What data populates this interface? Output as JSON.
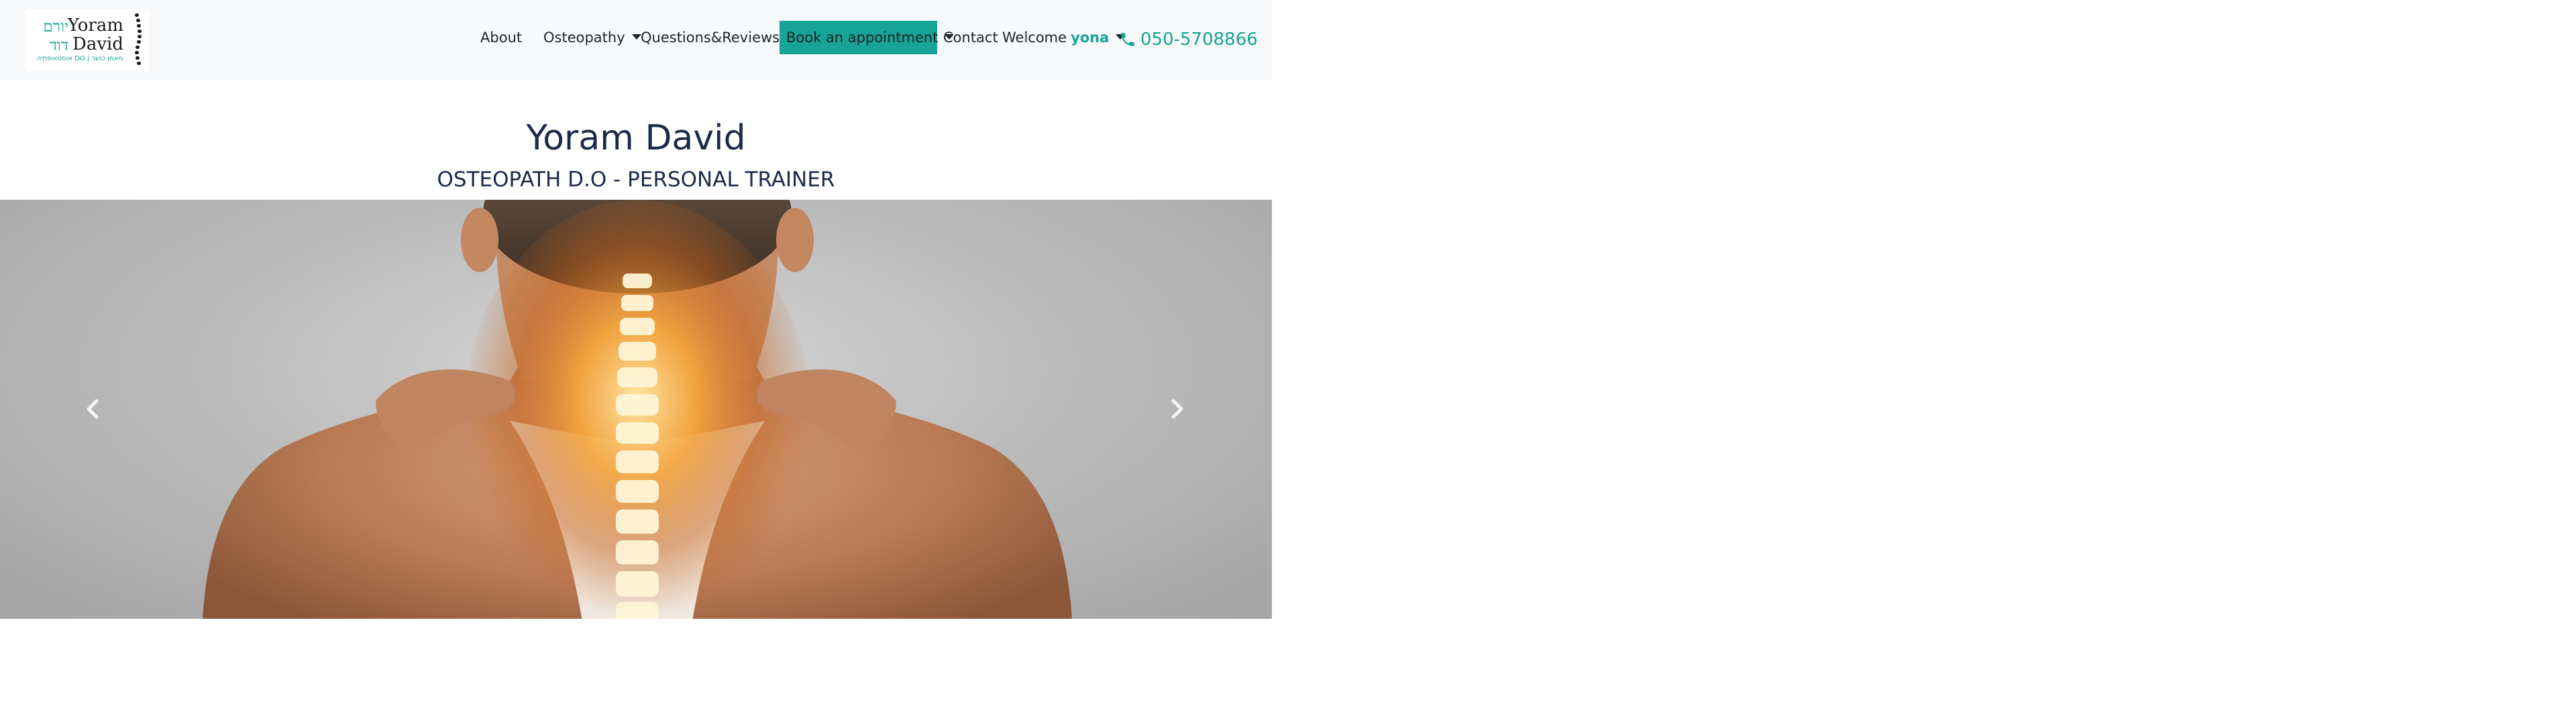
{
  "logo": {
    "name_en": "Yoram David",
    "name_he": "יורם דוד",
    "tagline": "אוסטאופתיה DO | מאמן כושר"
  },
  "nav": {
    "about": "About",
    "osteopathy": "Osteopathy",
    "questions_reviews": "Questions&Reviews",
    "book": "Book an appointment",
    "contact": "Contact",
    "welcome": "Welcome",
    "user": "yona"
  },
  "phone": "050-5708866",
  "hero": {
    "title": "Yoram David",
    "subtitle": "OSTEOPATH D.O - PERSONAL TRAINER"
  },
  "carousel": {
    "image": "woman-neck-pain-spine-highlight",
    "prev_icon": "chevron-left-icon",
    "next_icon": "chevron-right-icon"
  },
  "colors": {
    "accent": "#17a398",
    "navbar_bg": "#f8f9fa",
    "title": "#1b2a48"
  }
}
